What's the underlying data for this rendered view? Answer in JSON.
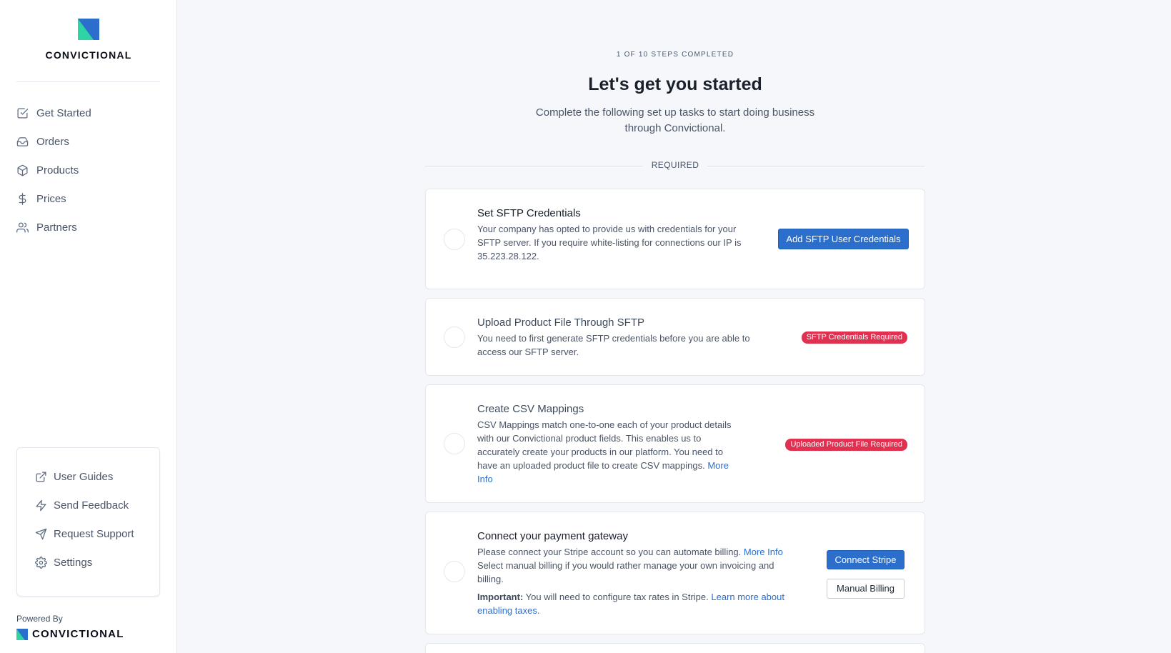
{
  "brand": {
    "name": "CONVICTIONAL"
  },
  "sidebar": {
    "items": [
      {
        "label": "Get Started",
        "icon": "checkbox-icon"
      },
      {
        "label": "Orders",
        "icon": "inbox-icon"
      },
      {
        "label": "Products",
        "icon": "box-icon"
      },
      {
        "label": "Prices",
        "icon": "dollar-icon"
      },
      {
        "label": "Partners",
        "icon": "users-icon"
      }
    ],
    "help": [
      {
        "label": "User Guides",
        "icon": "external-link-icon"
      },
      {
        "label": "Send Feedback",
        "icon": "lightning-icon"
      },
      {
        "label": "Request Support",
        "icon": "send-icon"
      },
      {
        "label": "Settings",
        "icon": "gear-icon"
      }
    ],
    "powered_by": "Powered By",
    "powered_brand": "CONVICTIONAL"
  },
  "main": {
    "progress": "1 OF 10 STEPS COMPLETED",
    "title": "Let's get you started",
    "subtitle": "Complete the following set up tasks to start doing business through Convictional.",
    "section_label": "REQUIRED",
    "tasks": [
      {
        "title": "Set SFTP Credentials",
        "text": "Your company has opted to provide us with credentials for your SFTP server. If you require white-listing for connections our IP is 35.223.28.122.",
        "button": "Add SFTP User Credentials"
      },
      {
        "title": "Upload Product File Through SFTP",
        "text": "You need to first generate SFTP credentials before you are able to access our SFTP server.",
        "badge": "SFTP Credentials Required"
      },
      {
        "title": "Create CSV Mappings",
        "text": "CSV Mappings match one-to-one each of your product details with our Convictional product fields. This enables us to accurately create your products in our platform. You need to have an uploaded product file to create CSV mappings.",
        "link": "More Info",
        "badge": "Uploaded Product File Required"
      },
      {
        "title": "Connect your payment gateway",
        "text1": "Please connect your Stripe account so you can automate billing.",
        "link1": "More Info",
        "text2": "Select manual billing if you would rather manage your own invoicing and billing.",
        "important_label": "Important:",
        "important_text": "You will need to configure tax rates in Stripe.",
        "link2": "Learn more about enabling taxes.",
        "button_primary": "Connect Stripe",
        "button_secondary": "Manual Billing"
      }
    ]
  },
  "colors": {
    "accent": "#2c6ecb",
    "danger": "#e03151",
    "logo_blue": "#2c6ecb",
    "logo_teal": "#2fd3a4"
  }
}
